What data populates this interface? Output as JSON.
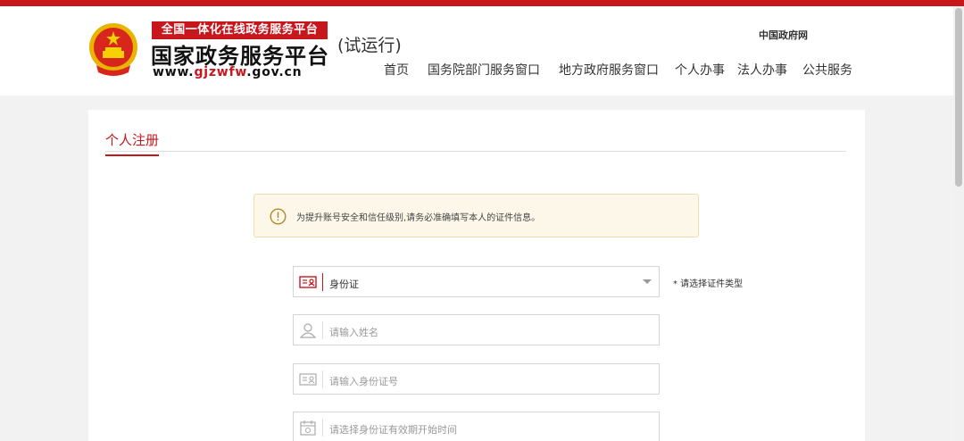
{
  "header": {
    "banner": "全国一体化在线政务服务平台",
    "title": "国家政务服务平台",
    "url_prefix": "www.",
    "url_red": "gjzwfw",
    "url_suffix": ".gov.cn",
    "trial": "(试运行)",
    "gov_link": "中国政府网",
    "nav": [
      "首页",
      "国务院部门服务窗口",
      "地方政府服务窗口",
      "个人办事",
      "法人办事",
      "公共服务"
    ]
  },
  "page": {
    "tab": "个人注册",
    "notice": "为提升账号安全和信任级别,请务必准确填写本人的证件信息。",
    "id_type": {
      "value": "身份证",
      "hint": "* 请选择证件类型"
    },
    "name_field": {
      "placeholder": "请输入姓名"
    },
    "id_number_field": {
      "placeholder": "请输入身份证号"
    },
    "valid_from_field": {
      "placeholder": "请选择身份证有效期开始时间"
    }
  },
  "colors": {
    "brand_red": "#c8161d",
    "notice_bg": "#fcf7e8",
    "page_bg": "#f2f2f2"
  },
  "icons": [
    "national-emblem",
    "warning-circle-icon",
    "id-card-icon",
    "user-icon",
    "calendar-icon",
    "chevron-down-icon"
  ]
}
